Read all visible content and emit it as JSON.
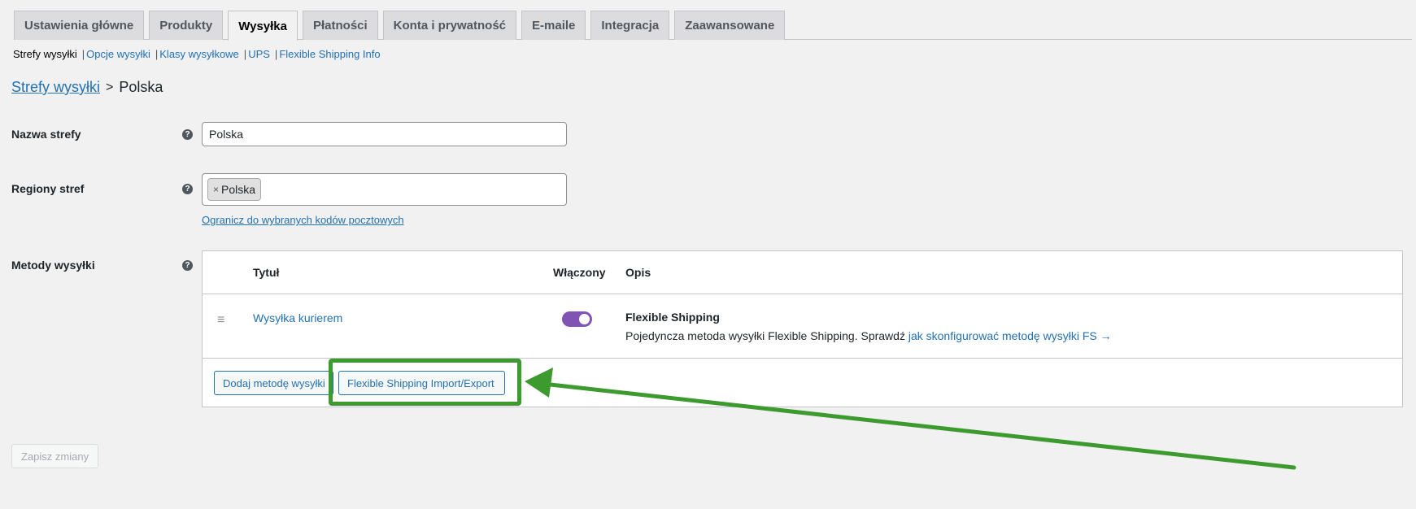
{
  "tabs": [
    {
      "label": "Ustawienia główne",
      "active": false
    },
    {
      "label": "Produkty",
      "active": false
    },
    {
      "label": "Wysyłka",
      "active": true
    },
    {
      "label": "Płatności",
      "active": false
    },
    {
      "label": "Konta i prywatność",
      "active": false
    },
    {
      "label": "E-maile",
      "active": false
    },
    {
      "label": "Integracja",
      "active": false
    },
    {
      "label": "Zaawansowane",
      "active": false
    }
  ],
  "subnav": {
    "current": "Strefy wysyłki",
    "links": [
      "Opcje wysyłki",
      "Klasy wysyłkowe",
      "UPS",
      "Flexible Shipping Info"
    ],
    "separator": "|"
  },
  "breadcrumb": {
    "parent": "Strefy wysyłki",
    "separator": ">",
    "current": "Polska"
  },
  "form": {
    "zone_name_label": "Nazwa strefy",
    "zone_name_value": "Polska",
    "regions_label": "Regiony stref",
    "region_chip_remove": "×",
    "region_chip": "Polska",
    "postcode_link": "Ogranicz do wybranych kodów pocztowych",
    "methods_label": "Metody wysyłki",
    "help_glyph": "?"
  },
  "methods_table": {
    "headers": {
      "title": "Tytuł",
      "enabled": "Włączony",
      "description": "Opis"
    },
    "rows": [
      {
        "drag_glyph": "≡",
        "title": "Wysyłka kurierem",
        "enabled": true,
        "desc_title": "Flexible Shipping",
        "desc_text": "Pojedyncza metoda wysyłki Flexible Shipping. Sprawdź",
        "desc_link": "jak skonfigurować metodę wysyłki FS →"
      }
    ],
    "add_button": "Dodaj metodę wysyłki",
    "import_export_button": "Flexible Shipping Import/Export"
  },
  "save_button": "Zapisz zmiany",
  "colors": {
    "accent": "#2271b1",
    "toggle_on": "#7f54b3",
    "annotation": "#3c9a2f"
  }
}
